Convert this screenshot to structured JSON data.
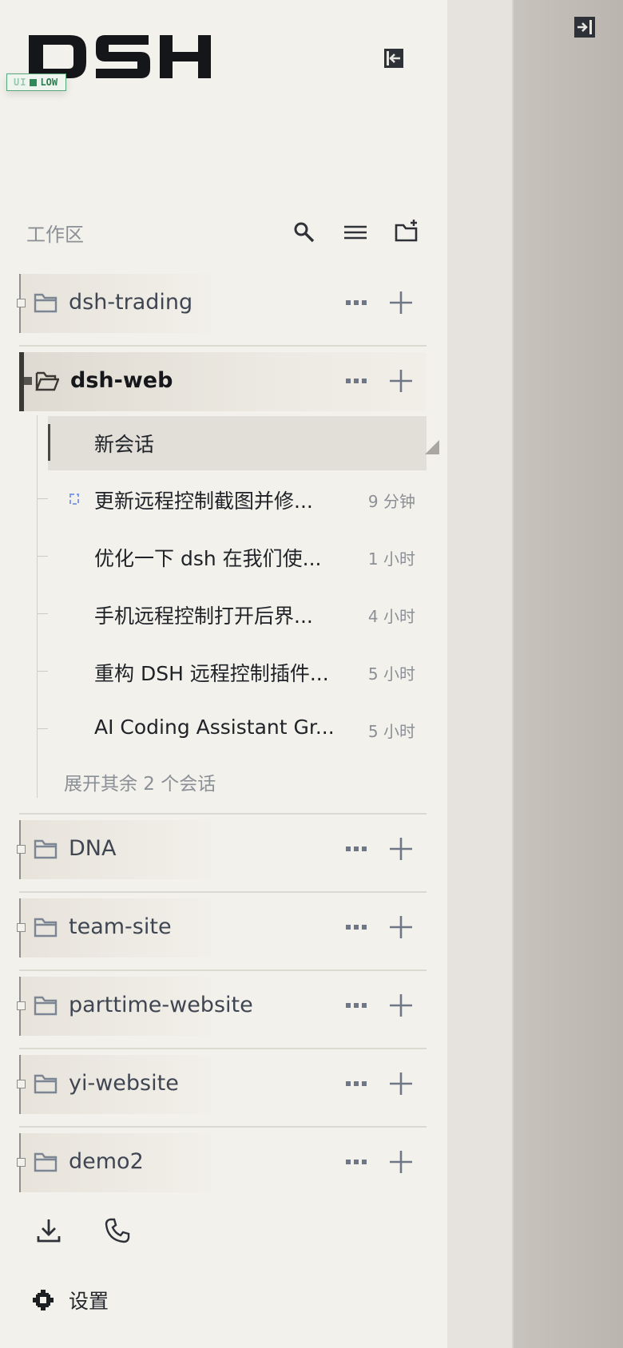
{
  "app": {
    "logo_text": "DSH",
    "env_badge": {
      "faded_text": "UI",
      "level": "LOW"
    }
  },
  "workspace": {
    "title": "工作区",
    "icons": [
      "search-icon",
      "list-icon",
      "new-folder-icon"
    ]
  },
  "projects": [
    {
      "name": "dsh-trading",
      "expanded": false
    },
    {
      "name": "dsh-web",
      "expanded": true
    },
    {
      "name": "DNA",
      "expanded": false
    },
    {
      "name": "team-site",
      "expanded": false
    },
    {
      "name": "parttime-website",
      "expanded": false
    },
    {
      "name": "yi-website",
      "expanded": false
    },
    {
      "name": "demo2",
      "expanded": false
    }
  ],
  "sessions": [
    {
      "title": "新会话",
      "time": "",
      "active": true
    },
    {
      "title": "更新远程控制截图并修...",
      "time": "9 分钟",
      "active": false
    },
    {
      "title": "优化一下 dsh 在我们使...",
      "time": "1 小时",
      "active": false
    },
    {
      "title": "手机远程控制打开后界...",
      "time": "4 小时",
      "active": false
    },
    {
      "title": "重构 DSH 远程控制插件...",
      "time": "5 小时",
      "active": false
    },
    {
      "title": "AI Coding Assistant Gr...",
      "time": "5 小时",
      "active": false
    }
  ],
  "expand_more": "展开其余 2 个会话",
  "footer": {
    "icons": [
      "download-icon",
      "phone-icon"
    ],
    "settings_label": "设置"
  },
  "colors": {
    "sidebar_bg": "#f3f1eb",
    "main_bg": "#e6e3de",
    "badge_green": "#2e8a57",
    "muted_text": "#8b8f96"
  }
}
